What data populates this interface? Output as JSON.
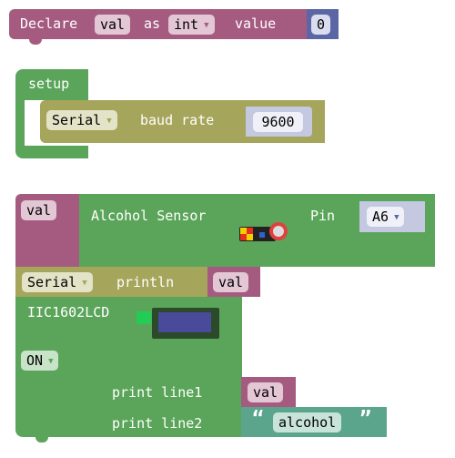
{
  "declare": {
    "label_declare": "Declare",
    "var_name": "val",
    "label_as": "as",
    "type": "int",
    "label_value": "value",
    "initial_value": "0"
  },
  "setup": {
    "label": "setup",
    "serial_port": "Serial",
    "label_baud": "baud rate",
    "baud": "9600"
  },
  "sensor": {
    "var_name": "val",
    "label": "Alcohol Sensor",
    "label_pin": "Pin",
    "pin": "A6"
  },
  "println": {
    "serial_port": "Serial",
    "label": "println",
    "value": "val"
  },
  "lcd": {
    "label": "IIC1602LCD",
    "state": "ON",
    "label_line1": "print line1",
    "line1_value": "val",
    "label_line2": "print line2",
    "line2_open_quote": "“",
    "line2_text": "alcohol",
    "line2_close_quote": "”"
  },
  "colors": {
    "variables": "#A55B80",
    "arduino": "#5BA55B",
    "serial": "#A5A55B",
    "math": "#5B67A5",
    "text": "#5BA58C"
  }
}
